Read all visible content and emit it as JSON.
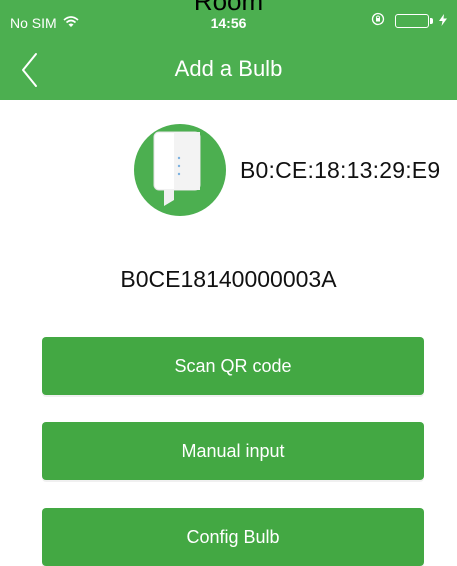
{
  "clipped_top_text": "Room",
  "status_bar": {
    "carrier": "No SIM",
    "time": "14:56",
    "wifi_icon": "wifi-icon",
    "rotation_lock_icon": "rotation-lock-icon",
    "battery_icon": "battery-icon",
    "charging_icon": "charging-icon"
  },
  "nav": {
    "title": "Add a Bulb",
    "back_icon": "chevron-left-icon"
  },
  "device": {
    "icon": "bulb-device-icon",
    "mac_address": "B0:CE:18:13:29:E9",
    "serial_number": "B0CE18140000003A"
  },
  "actions": {
    "scan_qr_label": "Scan QR code",
    "manual_input_label": "Manual input",
    "config_bulb_label": "Config Bulb"
  },
  "colors": {
    "header_green": "#4caf50",
    "button_green": "#43a843"
  }
}
